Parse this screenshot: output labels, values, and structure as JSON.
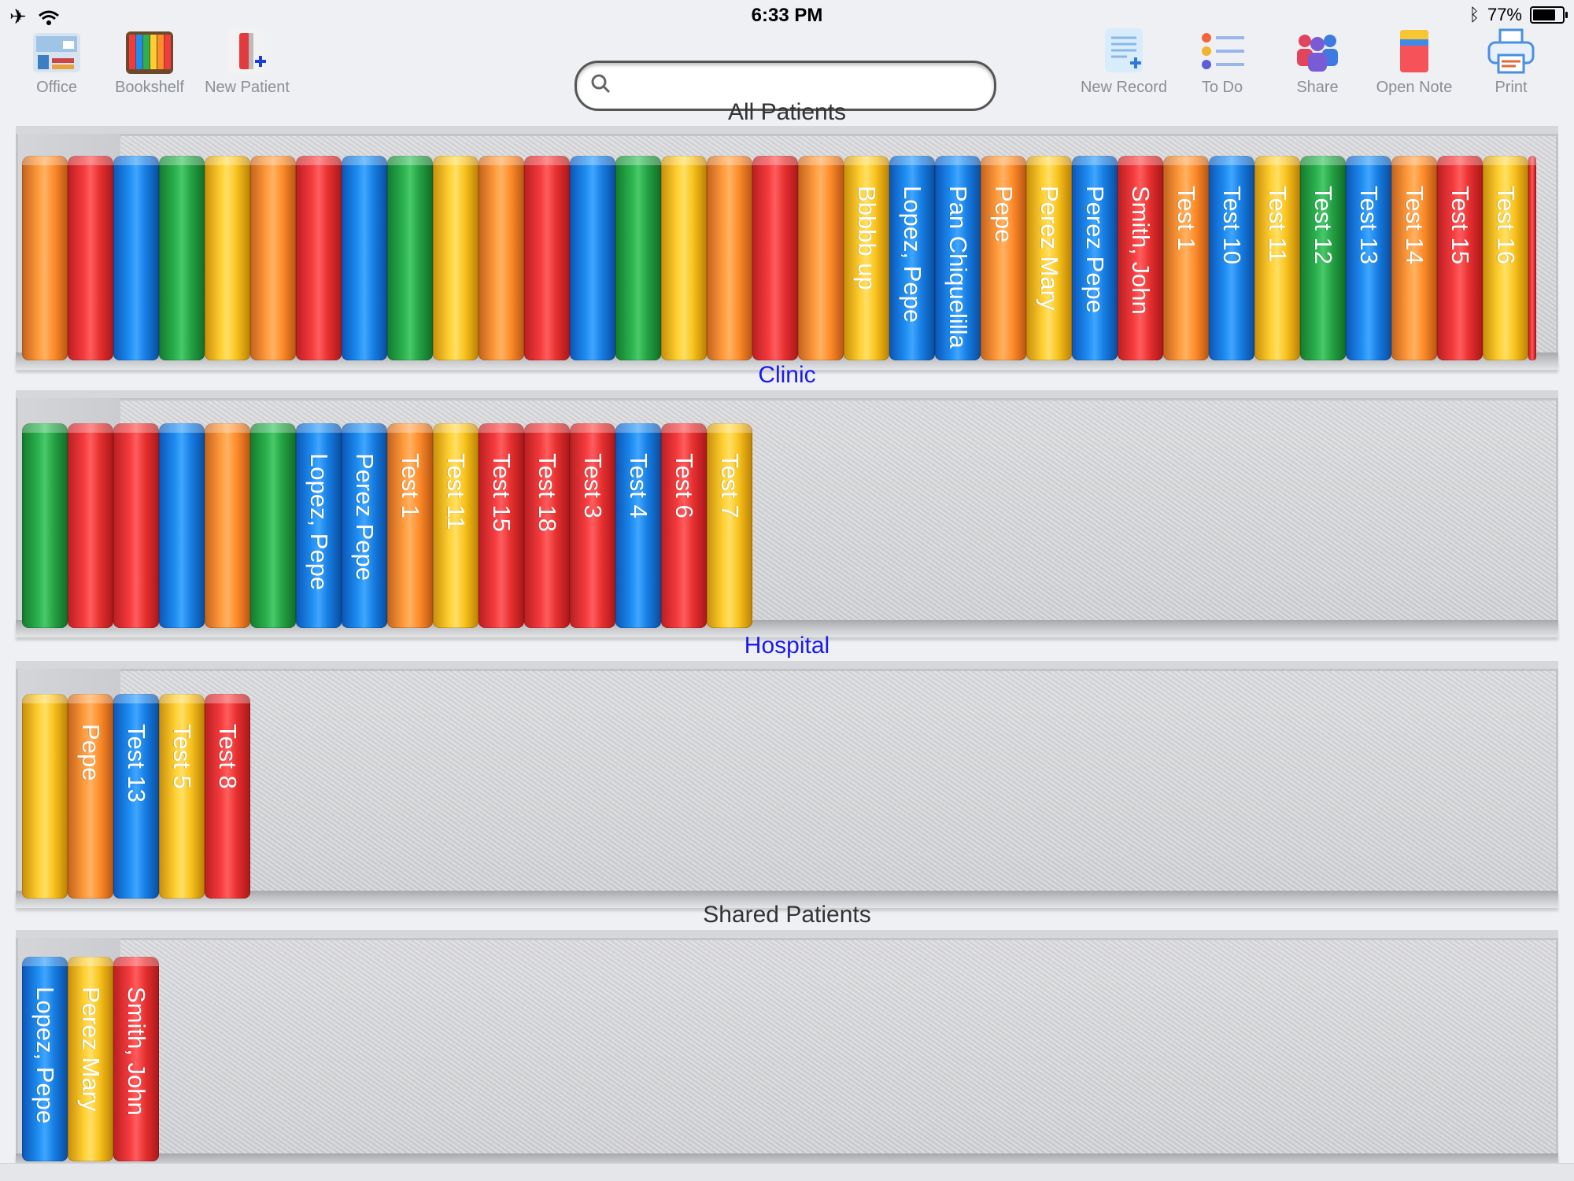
{
  "status_bar": {
    "time": "6:33 PM",
    "battery_percent": "77%",
    "battery_level": 0.77
  },
  "toolbar": {
    "left_buttons": [
      {
        "label": "Office",
        "icon": "office-icon"
      },
      {
        "label": "Bookshelf",
        "icon": "bookshelf-icon"
      },
      {
        "label": "New Patient",
        "icon": "new-patient-icon"
      }
    ],
    "right_buttons": [
      {
        "label": "New Record",
        "icon": "new-record-icon"
      },
      {
        "label": "To Do",
        "icon": "todo-list-icon"
      },
      {
        "label": "Share",
        "icon": "share-people-icon"
      },
      {
        "label": "Open Note",
        "icon": "open-note-icon"
      },
      {
        "label": "Print",
        "icon": "printer-icon"
      }
    ],
    "search_value": "",
    "search_placeholder": ""
  },
  "colors": {
    "orange": "#ff8c2a",
    "red": "#f53a3d",
    "blue": "#1e8df2",
    "green": "#2bb14e",
    "yellow": "#ffcf2f",
    "shelf_title_link": "#1a1aee",
    "shelf_title_plain": "#333333"
  },
  "shelves": [
    {
      "title": "All Patients",
      "title_color": "plain",
      "books": [
        {
          "color": "orange",
          "label": ""
        },
        {
          "color": "red",
          "label": ""
        },
        {
          "color": "blue",
          "label": ""
        },
        {
          "color": "green",
          "label": ""
        },
        {
          "color": "yellow",
          "label": ""
        },
        {
          "color": "orange",
          "label": ""
        },
        {
          "color": "red",
          "label": ""
        },
        {
          "color": "blue",
          "label": ""
        },
        {
          "color": "green",
          "label": ""
        },
        {
          "color": "yellow",
          "label": ""
        },
        {
          "color": "orange",
          "label": ""
        },
        {
          "color": "red",
          "label": ""
        },
        {
          "color": "blue",
          "label": ""
        },
        {
          "color": "green",
          "label": ""
        },
        {
          "color": "yellow",
          "label": ""
        },
        {
          "color": "orange",
          "label": ""
        },
        {
          "color": "red",
          "label": ""
        },
        {
          "color": "orange",
          "label": ""
        },
        {
          "color": "yellow",
          "label": "Bbbbb up"
        },
        {
          "color": "blue",
          "label": "Lopez, Pepe"
        },
        {
          "color": "blue",
          "label": "Pan Chiquelilla"
        },
        {
          "color": "orange",
          "label": "Pepe"
        },
        {
          "color": "yellow",
          "label": "Perez Mary"
        },
        {
          "color": "blue",
          "label": "Perez Pepe"
        },
        {
          "color": "red",
          "label": "Smith, John"
        },
        {
          "color": "orange",
          "label": "Test 1"
        },
        {
          "color": "blue",
          "label": "Test 10"
        },
        {
          "color": "yellow",
          "label": "Test 11"
        },
        {
          "color": "green",
          "label": "Test 12"
        },
        {
          "color": "blue",
          "label": "Test 13"
        },
        {
          "color": "orange",
          "label": "Test 14"
        },
        {
          "color": "red",
          "label": "Test 15"
        },
        {
          "color": "yellow",
          "label": "Test 16"
        },
        {
          "color": "red",
          "label": "",
          "sliver": true
        }
      ]
    },
    {
      "title": "Clinic",
      "title_color": "link",
      "books": [
        {
          "color": "green",
          "label": ""
        },
        {
          "color": "red",
          "label": ""
        },
        {
          "color": "red",
          "label": ""
        },
        {
          "color": "blue",
          "label": ""
        },
        {
          "color": "orange",
          "label": ""
        },
        {
          "color": "green",
          "label": ""
        },
        {
          "color": "blue",
          "label": "Lopez, Pepe"
        },
        {
          "color": "blue",
          "label": "Perez Pepe"
        },
        {
          "color": "orange",
          "label": "Test 1"
        },
        {
          "color": "yellow",
          "label": "Test 11"
        },
        {
          "color": "red",
          "label": "Test 15"
        },
        {
          "color": "red",
          "label": "Test 18"
        },
        {
          "color": "red",
          "label": "Test 3"
        },
        {
          "color": "blue",
          "label": "Test 4"
        },
        {
          "color": "red",
          "label": "Test 6"
        },
        {
          "color": "yellow",
          "label": "Test 7"
        }
      ]
    },
    {
      "title": "Hospital",
      "title_color": "link",
      "books": [
        {
          "color": "yellow",
          "label": ""
        },
        {
          "color": "orange",
          "label": "Pepe"
        },
        {
          "color": "blue",
          "label": "Test 13"
        },
        {
          "color": "yellow",
          "label": "Test 5"
        },
        {
          "color": "red",
          "label": "Test 8"
        }
      ]
    },
    {
      "title": "Shared Patients",
      "title_color": "plain",
      "books": [
        {
          "color": "blue",
          "label": "Lopez, Pepe"
        },
        {
          "color": "yellow",
          "label": "Perez Mary"
        },
        {
          "color": "red",
          "label": "Smith, John"
        }
      ]
    }
  ]
}
